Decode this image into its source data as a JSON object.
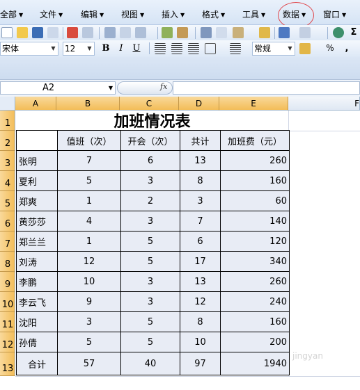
{
  "menu": {
    "items": [
      "全部",
      "文件",
      "编辑",
      "视图",
      "插入",
      "格式",
      "工具",
      "数据",
      "窗口"
    ]
  },
  "format_toolbar": {
    "font_name": "宋体",
    "font_size": "12",
    "bold": "B",
    "italic": "I",
    "underline": "U",
    "number_format": "常规",
    "percent": "%",
    "comma": ","
  },
  "formula_bar": {
    "name_box": "A2",
    "fx_label": "fx",
    "formula": ""
  },
  "columns": [
    "A",
    "B",
    "C",
    "D",
    "E",
    "F"
  ],
  "rows": [
    "1",
    "2",
    "3",
    "4",
    "5",
    "6",
    "7",
    "8",
    "9",
    "10",
    "11",
    "12",
    "13"
  ],
  "sheet": {
    "title": "加班情况表",
    "headers": [
      "",
      "值班（次）",
      "开会（次）",
      "共计",
      "加班费（元）"
    ],
    "records": [
      {
        "name": "张明",
        "duty": "7",
        "meetings": "6",
        "total": "13",
        "fee": "260"
      },
      {
        "name": "夏利",
        "duty": "5",
        "meetings": "3",
        "total": "8",
        "fee": "160"
      },
      {
        "name": "郑爽",
        "duty": "1",
        "meetings": "2",
        "total": "3",
        "fee": "60"
      },
      {
        "name": "黄莎莎",
        "duty": "4",
        "meetings": "3",
        "total": "7",
        "fee": "140"
      },
      {
        "name": "郑兰兰",
        "duty": "1",
        "meetings": "5",
        "total": "6",
        "fee": "120"
      },
      {
        "name": "刘涛",
        "duty": "12",
        "meetings": "5",
        "total": "17",
        "fee": "340"
      },
      {
        "name": "李鹏",
        "duty": "10",
        "meetings": "3",
        "total": "13",
        "fee": "260"
      },
      {
        "name": "李云飞",
        "duty": "9",
        "meetings": "3",
        "total": "12",
        "fee": "240"
      },
      {
        "name": "沈阳",
        "duty": "3",
        "meetings": "5",
        "total": "8",
        "fee": "160"
      },
      {
        "name": "孙倩",
        "duty": "5",
        "meetings": "5",
        "total": "10",
        "fee": "200"
      }
    ],
    "totals": {
      "name": "合计",
      "duty": "57",
      "meetings": "40",
      "total": "97",
      "fee": "1940"
    }
  },
  "colors": {
    "menu_bg": "#d6e4f5",
    "selected_header": "#f3bd58",
    "cell_fill": "#e8ecf5",
    "highlight_circle": "#e0474c"
  }
}
